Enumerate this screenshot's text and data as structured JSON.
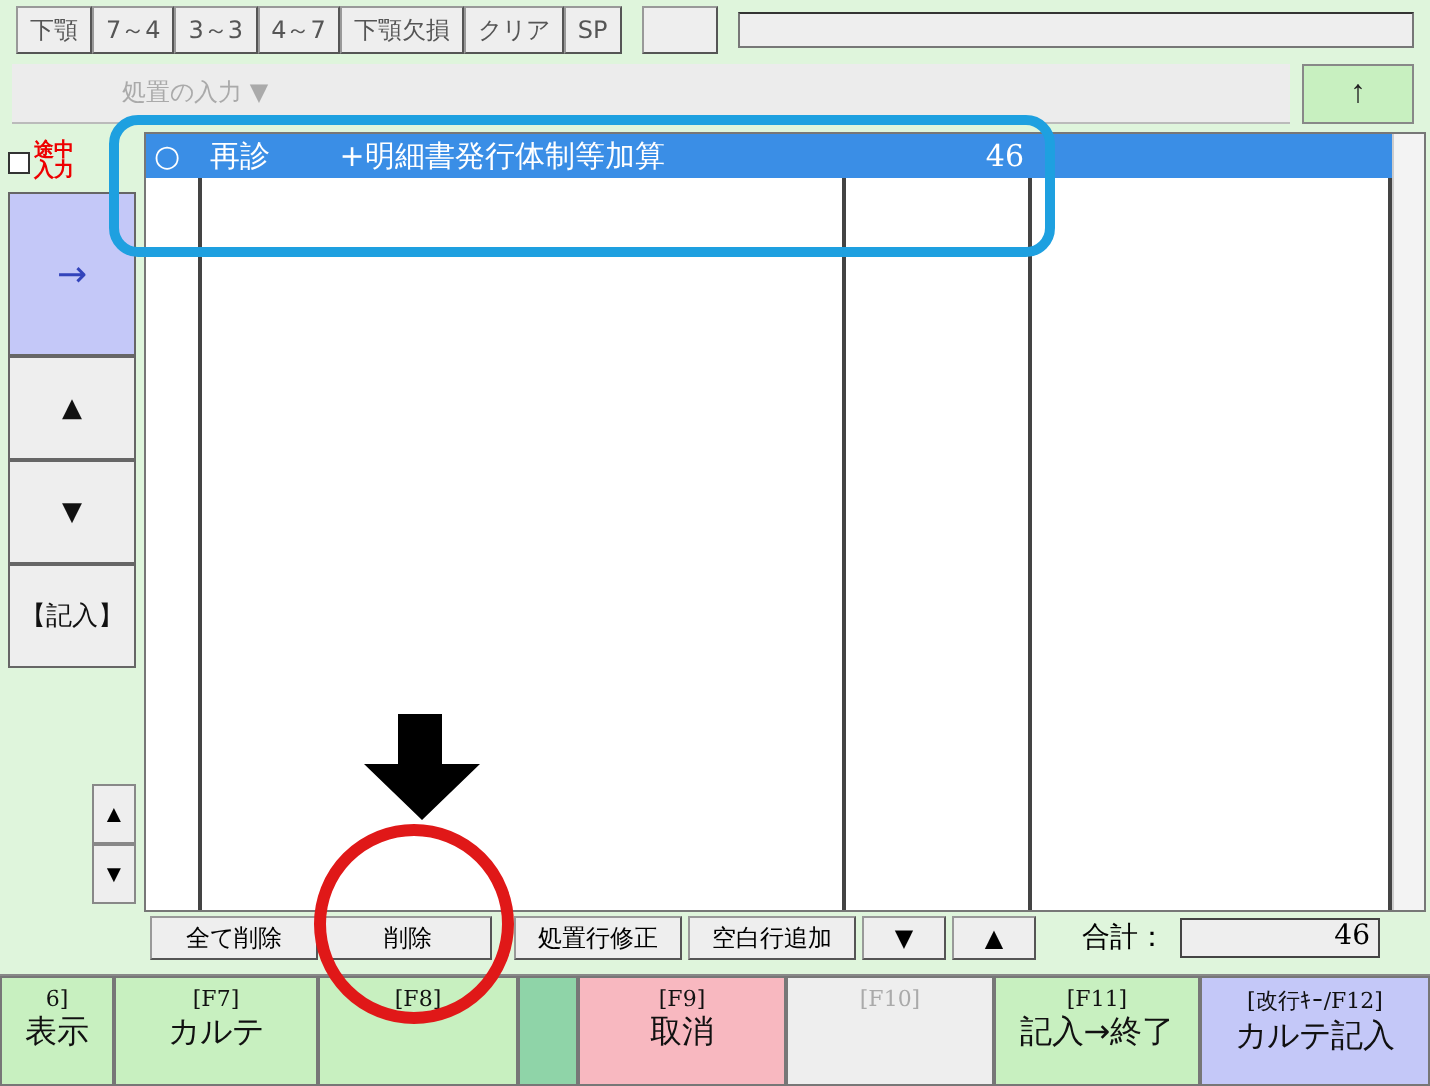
{
  "tooth_buttons": [
    "下顎",
    "7～4",
    "3～3",
    "4～7",
    "下顎欠損",
    "クリア",
    "SP"
  ],
  "procedure_select": {
    "placeholder": "処置の入力 ▼"
  },
  "up_button": "↑",
  "partial_entry": {
    "label": "途中入力",
    "checked": false
  },
  "side_buttons": [
    {
      "label": "→",
      "kind": "arrow"
    },
    {
      "label": "▲",
      "kind": "plain"
    },
    {
      "label": "▼",
      "kind": "plain"
    },
    {
      "label": "【記入】",
      "kind": "plain"
    }
  ],
  "small_scroll": [
    "▲",
    "▼"
  ],
  "rows": [
    {
      "mark": "○",
      "name": "再診　　 +明細書発行体制等加算",
      "points": "46",
      "selected": true
    }
  ],
  "list_actions": [
    "全て削除",
    "削除",
    "処置行修正",
    "空白行追加",
    "▼",
    "▲"
  ],
  "total": {
    "label": "合計：",
    "value": "46"
  },
  "function_keys": [
    {
      "key": "6]",
      "label": "表示",
      "kind": "normal",
      "disabled": false
    },
    {
      "key": "[F7]",
      "label": "カルテ",
      "kind": "normal",
      "disabled": false
    },
    {
      "key": "[F8]",
      "kind": "normal",
      "disabled": false
    },
    {
      "kind": "gap"
    },
    {
      "key": "[F9]",
      "label": "取消",
      "kind": "cancel",
      "disabled": false
    },
    {
      "key": "[F10]",
      "kind": "normal",
      "disabled": true
    },
    {
      "key": "[F11]",
      "label": "記入→終了",
      "kind": "normal",
      "disabled": false
    },
    {
      "key": "[改行ｷｰ/F12]",
      "label": "カルテ記入",
      "kind": "enter",
      "disabled": false
    }
  ]
}
